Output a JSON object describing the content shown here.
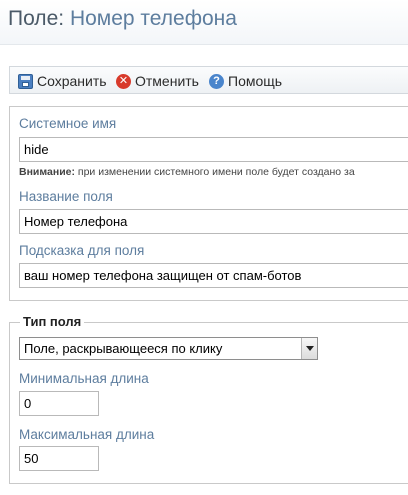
{
  "header": {
    "title_prefix": "Поле:",
    "title_name": "Номер телефона"
  },
  "toolbar": {
    "save_label": "Сохранить",
    "cancel_label": "Отменить",
    "help_label": "Помощь",
    "save_icon": "floppy-disk-icon",
    "cancel_icon": "red-x-circle-icon",
    "help_icon": "question-circle-icon"
  },
  "main_fields": {
    "system_name": {
      "label": "Системное имя",
      "value": "hide",
      "hint_bold": "Внимание:",
      "hint_text": " при изменении системного имени поле будет создано за"
    },
    "field_name": {
      "label": "Название поля",
      "value": "Номер телефона"
    },
    "field_hint": {
      "label": "Подсказка для поля",
      "value": "ваш номер телефона защищен от спам-ботов"
    }
  },
  "field_type": {
    "legend": "Тип поля",
    "select_value": "Поле, раскрывающееся по клику",
    "min_length": {
      "label": "Минимальная длина",
      "value": "0"
    },
    "max_length": {
      "label": "Максимальная длина",
      "value": "50"
    }
  },
  "colors": {
    "label": "#5d7d9e",
    "title_name": "#5d7d9e",
    "cancel_icon": "#d83a2b",
    "help_icon": "#4a85cc"
  }
}
